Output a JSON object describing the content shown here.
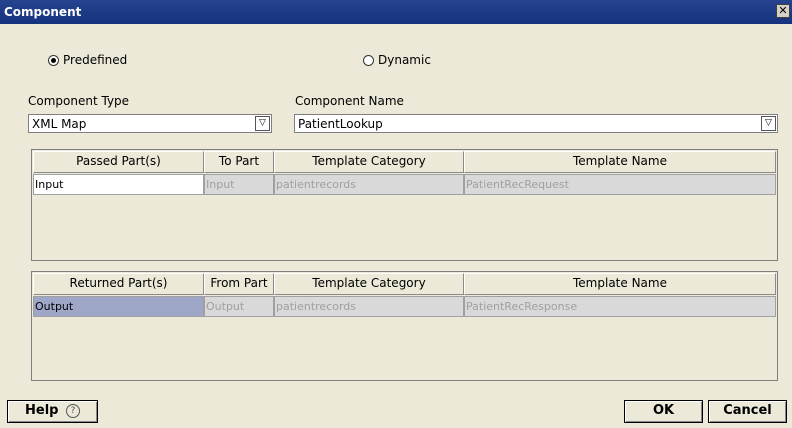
{
  "dialog": {
    "title": "Component",
    "close_glyph": "✕"
  },
  "radios": {
    "predefined": "Predefined",
    "dynamic": "Dynamic",
    "selected": "Predefined"
  },
  "component_type": {
    "label": "Component Type",
    "value": "XML Map"
  },
  "component_name": {
    "label": "Component Name",
    "value": "PatientLookup"
  },
  "passed_table": {
    "headers": [
      "Passed Part(s)",
      "To Part",
      "Template Category",
      "Template Name"
    ],
    "rows": [
      [
        "Input",
        "Input",
        "patientrecords",
        "PatientRecRequest"
      ]
    ]
  },
  "returned_table": {
    "headers": [
      "Returned Part(s)",
      "From Part",
      "Template Category",
      "Template Name"
    ],
    "rows": [
      [
        "Output",
        "Output",
        "patientrecords",
        "PatientRecResponse"
      ]
    ]
  },
  "buttons": {
    "help": "Help",
    "help_icon": "?",
    "ok": "OK",
    "cancel": "Cancel"
  },
  "icons": {
    "dropdown": "chevron-down-icon"
  }
}
